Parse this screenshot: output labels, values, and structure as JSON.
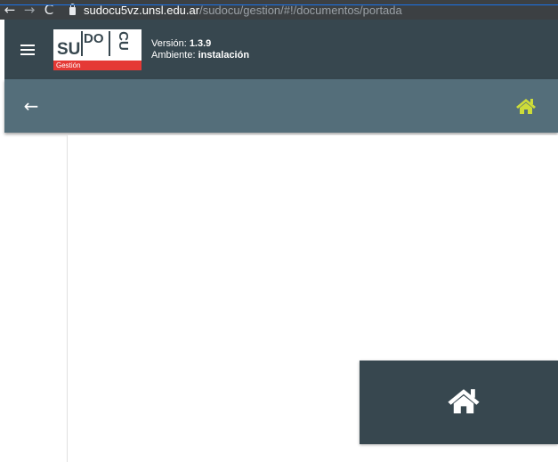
{
  "browser": {
    "back_icon": "arrow-left-icon",
    "back_glyph": "←",
    "forward_icon": "arrow-right-icon",
    "forward_glyph": "→",
    "reload_icon": "reload-icon",
    "reload_glyph": "C",
    "url_host": "sudocu5vz.unsl.edu.ar",
    "url_path": "/sudocu/gestion/#!/documentos/portada",
    "accent_color": "#1a73e8"
  },
  "header": {
    "menu_icon": "hamburger-menu-icon",
    "logo": {
      "part1": "SU",
      "part2": "DO",
      "part3": "CU",
      "subtitle": "Gestión",
      "accent_color": "#e53935"
    },
    "version_label": "Versión:",
    "version_value": "1.3.9",
    "environment_label": "Ambiente:",
    "environment_value": "instalación",
    "background_color": "#37474f"
  },
  "toolbar": {
    "back_icon": "arrow-left-icon",
    "back_glyph": "←",
    "home_icon": "home-icon",
    "home_icon_color": "#cddc39",
    "background_color": "#546e7a"
  },
  "home_card": {
    "icon": "home-icon",
    "icon_color": "#ffffff",
    "background_color": "#37474f"
  }
}
